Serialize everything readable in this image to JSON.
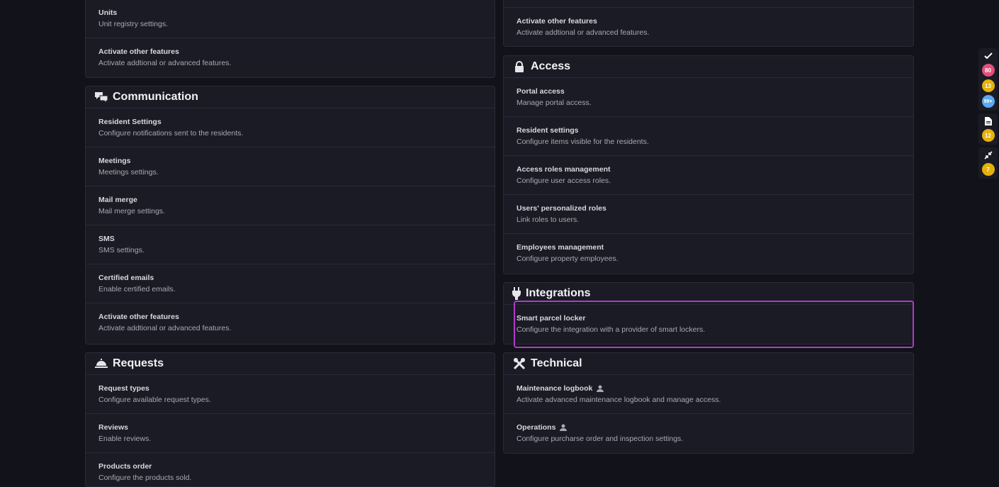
{
  "left": {
    "top_items": [
      {
        "title": "Units",
        "desc": "Unit registry settings."
      },
      {
        "title": "Activate other features",
        "desc": "Activate addtional or advanced features."
      }
    ],
    "communication": {
      "title": "Communication",
      "items": [
        {
          "title": "Resident Settings",
          "desc": "Configure notifications sent to the residents."
        },
        {
          "title": "Meetings",
          "desc": "Meetings settings."
        },
        {
          "title": "Mail merge",
          "desc": "Mail merge settings."
        },
        {
          "title": "SMS",
          "desc": "SMS settings."
        },
        {
          "title": "Certified emails",
          "desc": "Enable certified emails."
        },
        {
          "title": "Activate other features",
          "desc": "Activate addtional or advanced features."
        }
      ]
    },
    "requests": {
      "title": "Requests",
      "items": [
        {
          "title": "Request types",
          "desc": "Configure available request types."
        },
        {
          "title": "Reviews",
          "desc": "Enable reviews."
        },
        {
          "title": "Products order",
          "desc": "Configure the products sold."
        }
      ]
    }
  },
  "right": {
    "top_items": [
      {
        "title": "Activate other features",
        "desc": "Activate addtional or advanced features."
      }
    ],
    "access": {
      "title": "Access",
      "items": [
        {
          "title": "Portal access",
          "desc": "Manage portal access."
        },
        {
          "title": "Resident settings",
          "desc": "Configure items visible for the residents."
        },
        {
          "title": "Access roles management",
          "desc": "Configure user access roles."
        },
        {
          "title": "Users' personalized roles",
          "desc": "Link roles to users."
        },
        {
          "title": "Employees management",
          "desc": "Configure property employees."
        }
      ]
    },
    "integrations": {
      "title": "Integrations",
      "items": [
        {
          "title": "Smart parcel locker",
          "desc": "Configure the integration with a provider of smart lockers."
        }
      ]
    },
    "technical": {
      "title": "Technical",
      "items": [
        {
          "title": "Maintenance logbook",
          "desc": "Activate advanced maintenance logbook and manage access."
        },
        {
          "title": "Operations",
          "desc": "Configure purcharse order and inspection settings."
        }
      ]
    }
  },
  "rail": {
    "tasks_badges": [
      "80",
      "13",
      "99+"
    ],
    "docs_badge": "12",
    "collapse_badge": "7"
  },
  "colors": {
    "highlight": "#b03bc8",
    "badge_red": "#e0507a",
    "badge_yellow": "#e7b10a",
    "badge_blue": "#5aa9f0"
  }
}
